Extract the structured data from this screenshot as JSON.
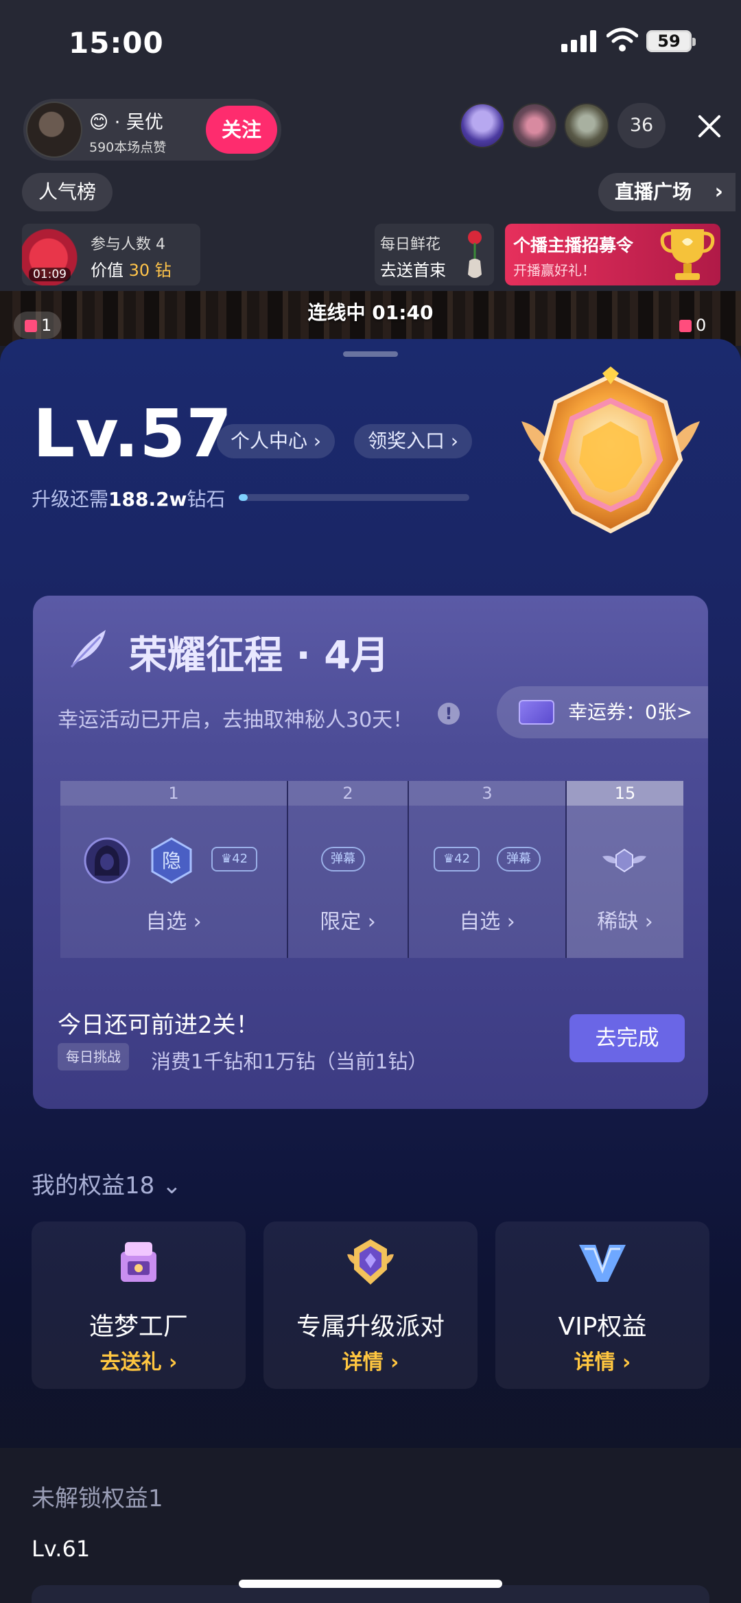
{
  "status_bar": {
    "time": "15:00",
    "battery": "59"
  },
  "anchor": {
    "name": "😊 · 吴优",
    "likes": "590本场点赞",
    "follow_label": "关注"
  },
  "viewers": {
    "count": "36"
  },
  "nav": {
    "rank_label": "人气榜",
    "plaza_label": "直播广场"
  },
  "fan_club": {
    "timer": "01:09",
    "participants": "参与人数 4",
    "value_prefix": "价值",
    "value": "30 钻"
  },
  "flower": {
    "line1": "每日鲜花",
    "line2": "去送首束"
  },
  "recruit": {
    "line1": "个播主播招募令",
    "line2": "开播赢好礼！"
  },
  "live_strip": {
    "status": "连线中 01:40",
    "left_gifts": "1",
    "right_gifts": "0"
  },
  "level": {
    "title": "Lv.57",
    "personal_center": "个人中心",
    "reward_entry": "领奖入口",
    "upgrade_prefix": "升级还需",
    "upgrade_amount": "188.2w",
    "upgrade_suffix": "钻石",
    "progress_fraction": 0.04
  },
  "glory": {
    "title": "荣耀征程 · 4月",
    "subtitle": "幸运活动已开启，去抽取神秘人30天！",
    "ticket_label": "幸运券：0张>",
    "stages": [
      {
        "number": "1",
        "label": "自选"
      },
      {
        "number": "2",
        "label": "限定"
      },
      {
        "number": "3",
        "label": "自选"
      },
      {
        "number": "15",
        "label": "稀缺"
      }
    ],
    "tags": {
      "hidden": "隐",
      "level_badge": "42",
      "danmaku": "弹幕"
    },
    "today_text": "今日还可前进2关！",
    "daily_tag": "每日挑战",
    "daily_desc": "消费1千钻和1万钻（当前1钻）",
    "go_label": "去完成"
  },
  "perks": {
    "title": "我的权益18",
    "items": [
      {
        "name": "造梦工厂",
        "link": "去送礼"
      },
      {
        "name": "专属升级派对",
        "link": "详情"
      },
      {
        "name": "VIP权益",
        "link": "详情"
      }
    ]
  },
  "locked": {
    "title": "未解锁权益1",
    "level": "Lv.61"
  },
  "colors": {
    "accent_pink": "#fe2c6e",
    "gold": "#ffc640",
    "button_purple": "#6a66e6",
    "panel_blue": "#1b2a6e"
  }
}
